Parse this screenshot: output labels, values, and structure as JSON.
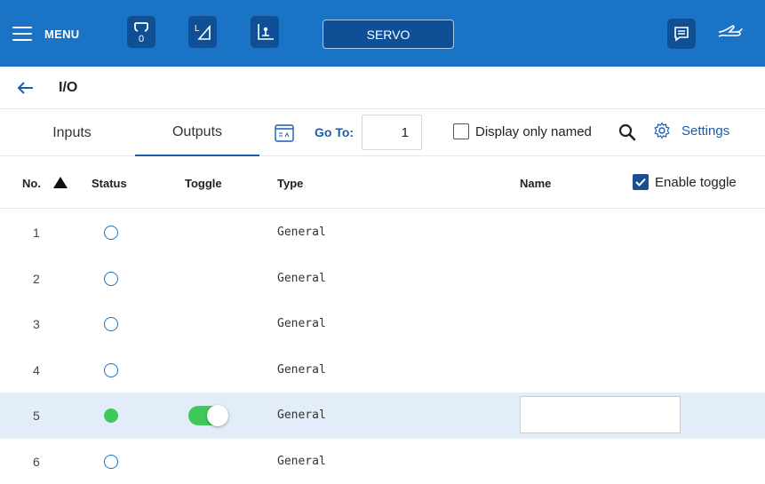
{
  "topbar": {
    "menu_label": "MENU",
    "tool_buttons": [
      {
        "icon": "gripper-icon",
        "badge": "0"
      },
      {
        "icon": "frame-icon",
        "label": "L"
      },
      {
        "icon": "coordinate-icon"
      }
    ],
    "servo_label": "SERVO",
    "right_buttons": [
      {
        "icon": "message-icon"
      },
      {
        "icon": "hand-icon"
      }
    ],
    "colors": {
      "bar": "#1a73c4",
      "button": "#0f4f96"
    }
  },
  "breadcrumb": {
    "title": "I/O"
  },
  "tabs": [
    {
      "label": "Inputs",
      "active": false
    },
    {
      "label": "Outputs",
      "active": true
    }
  ],
  "goto": {
    "label": "Go To:",
    "value": "1"
  },
  "display_named": {
    "label": "Display only named",
    "checked": false
  },
  "settings": {
    "label": "Settings"
  },
  "table": {
    "headers": {
      "no": "No.",
      "status": "Status",
      "toggle": "Toggle",
      "type": "Type",
      "name": "Name"
    },
    "sort": "ascending",
    "enable_toggle": {
      "label": "Enable toggle",
      "checked": true
    },
    "rows": [
      {
        "no": "1",
        "status": "off",
        "toggle": false,
        "type": "General",
        "name": ""
      },
      {
        "no": "2",
        "status": "off",
        "toggle": false,
        "type": "General",
        "name": ""
      },
      {
        "no": "3",
        "status": "off",
        "toggle": false,
        "type": "General",
        "name": ""
      },
      {
        "no": "4",
        "status": "off",
        "toggle": false,
        "type": "General",
        "name": ""
      },
      {
        "no": "5",
        "status": "on",
        "toggle": true,
        "type": "General",
        "name": "",
        "selected": true
      },
      {
        "no": "6",
        "status": "off",
        "toggle": false,
        "type": "General",
        "name": ""
      }
    ]
  },
  "colors": {
    "accent": "#1a5db0",
    "status_on": "#3ec95a",
    "row_highlight": "#e2edf9"
  }
}
